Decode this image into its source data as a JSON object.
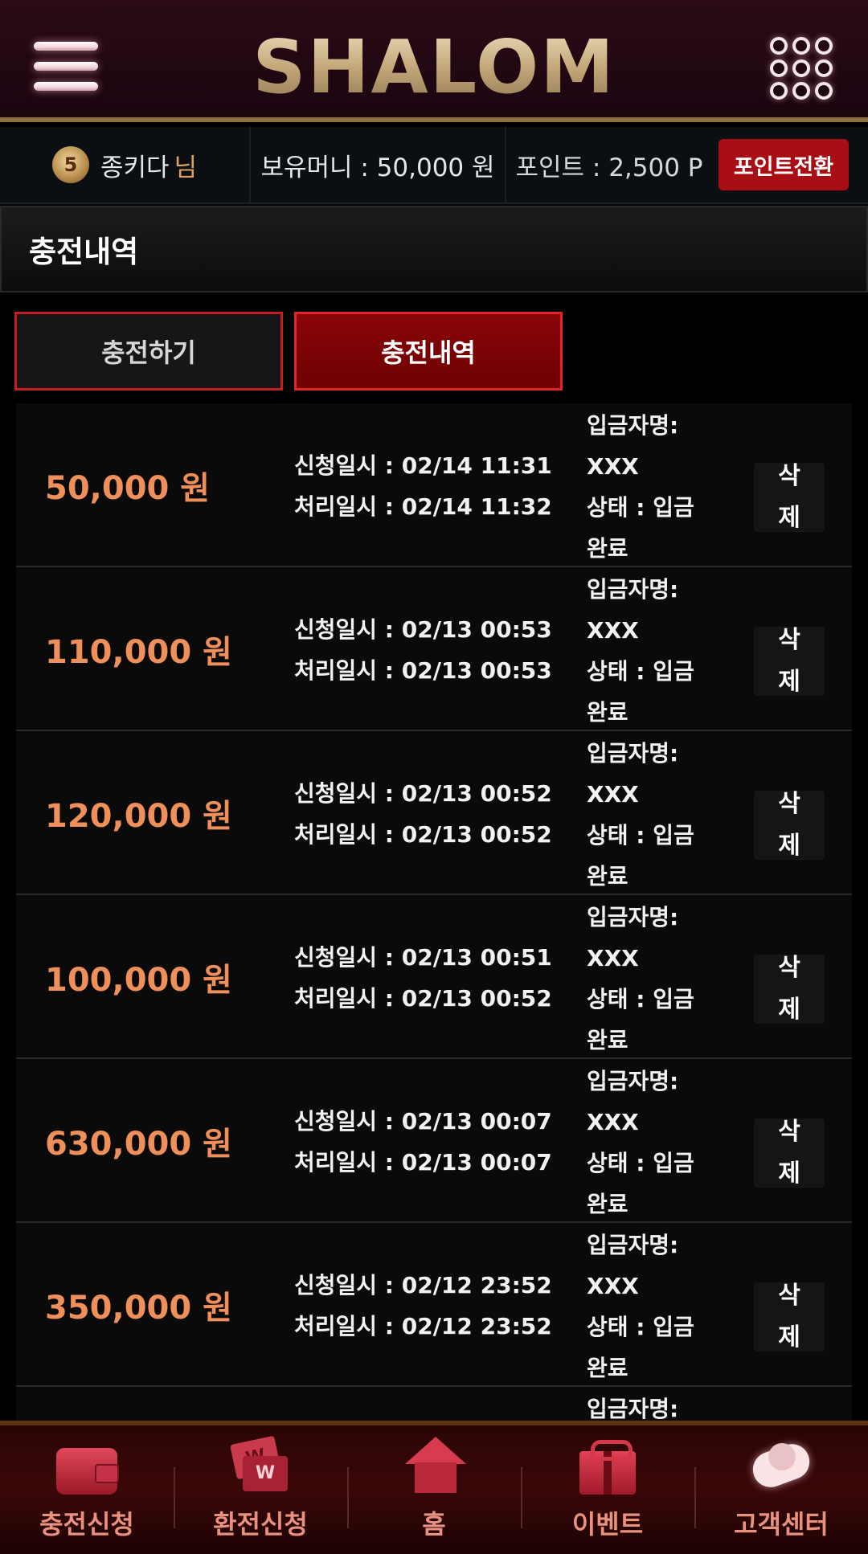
{
  "header": {
    "logo_text": "SHALOM"
  },
  "info_bar": {
    "level": "5",
    "user_name": "종키다",
    "user_suffix": "님",
    "money": "보유머니 : 50,000 원",
    "points": "포인트 : 2,500 P",
    "convert_label": "포인트전환"
  },
  "section_title": "충전내역",
  "tabs": {
    "charge": "충전하기",
    "history": "충전내역"
  },
  "history": [
    {
      "amount": "50,000 원",
      "requested": "신청일시 : 02/14 11:31",
      "processed": "처리일시 : 02/14 11:32",
      "depositor_label": "입금자명:",
      "depositor": "XXX",
      "status_line1": "상태 : 입금",
      "status_line2": "완료",
      "delete_label_1": "삭",
      "delete_label_2": "제"
    },
    {
      "amount": "110,000 원",
      "requested": "신청일시 : 02/13 00:53",
      "processed": "처리일시 : 02/13 00:53",
      "depositor_label": "입금자명:",
      "depositor": "XXX",
      "status_line1": "상태 : 입금",
      "status_line2": "완료",
      "delete_label_1": "삭",
      "delete_label_2": "제"
    },
    {
      "amount": "120,000 원",
      "requested": "신청일시 : 02/13 00:52",
      "processed": "처리일시 : 02/13 00:52",
      "depositor_label": "입금자명:",
      "depositor": "XXX",
      "status_line1": "상태 : 입금",
      "status_line2": "완료",
      "delete_label_1": "삭",
      "delete_label_2": "제"
    },
    {
      "amount": "100,000 원",
      "requested": "신청일시 : 02/13 00:51",
      "processed": "처리일시 : 02/13 00:52",
      "depositor_label": "입금자명:",
      "depositor": "XXX",
      "status_line1": "상태 : 입금",
      "status_line2": "완료",
      "delete_label_1": "삭",
      "delete_label_2": "제"
    },
    {
      "amount": "630,000 원",
      "requested": "신청일시 : 02/13 00:07",
      "processed": "처리일시 : 02/13 00:07",
      "depositor_label": "입금자명:",
      "depositor": "XXX",
      "status_line1": "상태 : 입금",
      "status_line2": "완료",
      "delete_label_1": "삭",
      "delete_label_2": "제"
    },
    {
      "amount": "350,000 원",
      "requested": "신청일시 : 02/12 23:52",
      "processed": "처리일시 : 02/12 23:52",
      "depositor_label": "입금자명:",
      "depositor": "XXX",
      "status_line1": "상태 : 입금",
      "status_line2": "완료",
      "delete_label_1": "삭",
      "delete_label_2": "제"
    }
  ],
  "partial_row": {
    "depositor_label": "입금자명:"
  },
  "bottom_nav": [
    {
      "label": "충전신청",
      "icon": "wallet-icon"
    },
    {
      "label": "환전신청",
      "icon": "exchange-icon"
    },
    {
      "label": "홈",
      "icon": "home-icon"
    },
    {
      "label": "이벤트",
      "icon": "gift-icon"
    },
    {
      "label": "고객센터",
      "icon": "handshake-icon"
    }
  ]
}
